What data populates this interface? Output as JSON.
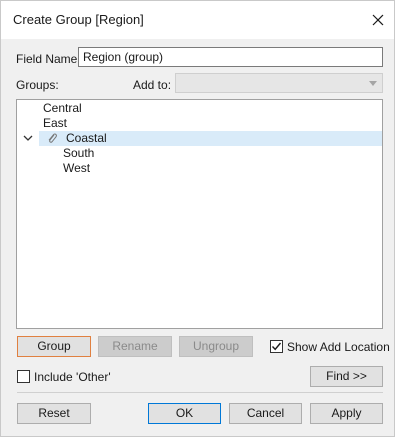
{
  "window": {
    "title": "Create Group [Region]"
  },
  "field_name": {
    "label": "Field Name:",
    "value": "Region (group)"
  },
  "groups_label": "Groups:",
  "add_to": {
    "label": "Add to:",
    "value": ""
  },
  "tree": {
    "items": [
      {
        "label": "Central",
        "expanded": false,
        "selected": false
      },
      {
        "label": "East",
        "expanded": false,
        "selected": false
      },
      {
        "label": "Coastal",
        "expanded": true,
        "selected": true,
        "icon": "paperclip-icon",
        "children": [
          {
            "label": "South"
          },
          {
            "label": "West"
          }
        ]
      }
    ]
  },
  "buttons": {
    "group": "Group",
    "rename": "Rename",
    "ungroup": "Ungroup",
    "find": "Find >>",
    "reset": "Reset",
    "ok": "OK",
    "cancel": "Cancel",
    "apply": "Apply"
  },
  "show_add_location": {
    "label": "Show Add Location",
    "checked": true
  },
  "include_other": {
    "label": "Include 'Other'",
    "checked": false
  },
  "colors": {
    "selection": "#d9ebf9",
    "accent_border": "#e08040",
    "default_border": "#0078d7"
  }
}
